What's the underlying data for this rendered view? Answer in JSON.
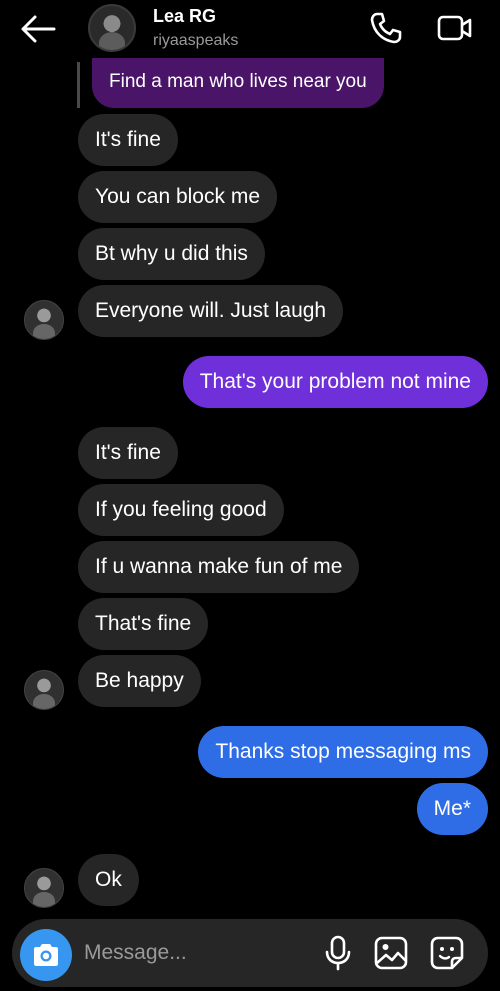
{
  "header": {
    "name": "Lea RG",
    "username": "riyaaspeaks",
    "back_icon": "arrow-left-icon",
    "call_icon": "phone-icon",
    "video_icon": "video-camera-icon"
  },
  "quoted_message": "Find a man who lives near you",
  "messages": [
    {
      "text": "It's fine",
      "from": "them"
    },
    {
      "text": "You can block me",
      "from": "them"
    },
    {
      "text": "Bt why u did this",
      "from": "them"
    },
    {
      "text": "Everyone will. Just laugh",
      "from": "them"
    },
    {
      "text": "That's your problem not mine",
      "from": "me"
    },
    {
      "text": "It's fine",
      "from": "them"
    },
    {
      "text": "If you feeling good",
      "from": "them"
    },
    {
      "text": "If u wanna make fun of me",
      "from": "them"
    },
    {
      "text": "That's fine",
      "from": "them"
    },
    {
      "text": "Be happy",
      "from": "them"
    },
    {
      "text": "Thanks stop messaging ms",
      "from": "me"
    },
    {
      "text": "Me*",
      "from": "me"
    },
    {
      "text": "Ok",
      "from": "them"
    }
  ],
  "composer": {
    "placeholder": "Message...",
    "camera_icon": "camera-icon",
    "mic_icon": "microphone-icon",
    "gallery_icon": "image-icon",
    "sticker_icon": "sticker-icon"
  },
  "colors": {
    "background": "#000000",
    "incoming_bubble": "#262626",
    "outgoing_purple": "#6f2fd9",
    "outgoing_blue": "#2f6de6",
    "accent": "#3797f0"
  }
}
